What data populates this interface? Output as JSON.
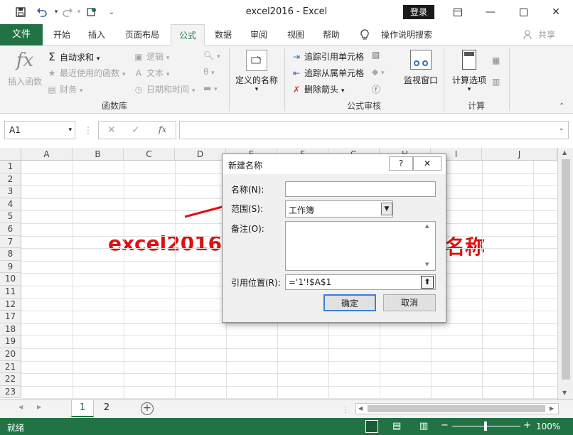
{
  "window": {
    "title": "excel2016 - Excel",
    "login": "登录",
    "share": "共享",
    "tell_me": "操作说明搜索"
  },
  "ribbon_tabs": [
    "文件",
    "开始",
    "插入",
    "页面布局",
    "公式",
    "数据",
    "审阅",
    "视图",
    "帮助"
  ],
  "ribbon": {
    "insert_function": "插入函数",
    "autosum": "自动求和",
    "recently_used": "最近使用的函数",
    "financial": "财务",
    "logical": "逻辑",
    "text": "文本",
    "datetime": "日期和时间",
    "group_function_library": "函数库",
    "defined_names": "定义的名称",
    "trace_precedents": "追踪引用单元格",
    "trace_dependents": "追踪从属单元格",
    "remove_arrows": "删除箭头",
    "watch_window": "监视窗口",
    "group_formula_auditing": "公式审核",
    "calc_options": "计算选项",
    "group_calculation": "计算"
  },
  "formula_bar": {
    "name_box": "A1",
    "fx": "fx",
    "content": ""
  },
  "grid": {
    "columns": [
      "A",
      "B",
      "C",
      "D",
      "E",
      "F",
      "G",
      "H",
      "I",
      "J"
    ],
    "rows": [
      "1",
      "2",
      "3",
      "4",
      "5",
      "6",
      "7",
      "8",
      "9",
      "10",
      "11",
      "12",
      "17",
      "18",
      "19",
      "20",
      "21",
      "22",
      "23"
    ]
  },
  "overlay": {
    "left_text": "excel2016",
    "right_text": "名称"
  },
  "dialog": {
    "title": "新建名称",
    "help": "?",
    "name_label": "名称(N):",
    "name_value": "",
    "scope_label": "范围(S):",
    "scope_value": "工作簿",
    "comment_label": "备注(O):",
    "comment_value": "",
    "refers_label": "引用位置(R):",
    "refers_value": "='1'!$A$1",
    "ok": "确定",
    "cancel": "取消"
  },
  "sheets": [
    "1",
    "2"
  ],
  "status": {
    "ready": "就绪",
    "zoom": "100%"
  },
  "colors": {
    "accent": "#217346",
    "annotation": "#e01010"
  }
}
